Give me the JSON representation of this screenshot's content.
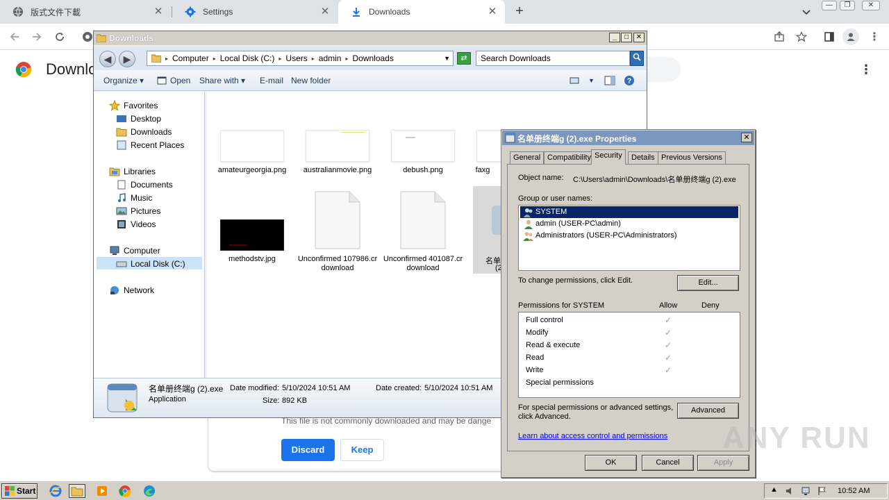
{
  "chrome": {
    "tabs": [
      {
        "label": "版式文件下載",
        "icon": "globe-icon"
      },
      {
        "label": "Settings",
        "icon": "gear-icon"
      },
      {
        "label": "Downloads",
        "icon": "download-icon",
        "active": true
      }
    ],
    "new_tab": "+",
    "page_title": "Downlo",
    "warning_text": "This file is not commonly downloaded and may be dange",
    "discard_label": "Discard",
    "keep_label": "Keep",
    "colors": {
      "tabbar": "#dee1e6",
      "primary": "#1a73e8"
    }
  },
  "explorer": {
    "title": "Downloads",
    "breadcrumb": [
      "Computer",
      "Local Disk (C:)",
      "Users",
      "admin",
      "Downloads"
    ],
    "search_placeholder": "Search Downloads",
    "commands": {
      "organize": "Organize",
      "open": "Open",
      "share": "Share with",
      "email": "E-mail",
      "new_folder": "New folder"
    },
    "nav": {
      "favorites": "Favorites",
      "favorites_items": [
        "Desktop",
        "Downloads",
        "Recent Places"
      ],
      "libraries": "Libraries",
      "libraries_items": [
        "Documents",
        "Music",
        "Pictures",
        "Videos"
      ],
      "computer": "Computer",
      "computer_items": [
        "Local Disk (C:)"
      ],
      "network": "Network"
    },
    "files": [
      {
        "name": "amateurgeorgia.png"
      },
      {
        "name": "australianmovie.png"
      },
      {
        "name": "debush.png"
      },
      {
        "name": "faxg"
      },
      {
        "name": "methodstv.jpg"
      },
      {
        "name": "Unconfirmed 107986.crdownload"
      },
      {
        "name": "Unconfirmed 401087.crdownload"
      },
      {
        "name": "名单"
      },
      {
        "name": "(2"
      }
    ],
    "details": {
      "filename": "名单册终端g (2).exe",
      "type": "Application",
      "date_modified_label": "Date modified:",
      "date_modified": "5/10/2024 10:51 AM",
      "date_created_label": "Date created:",
      "date_created": "5/10/2024 10:51 AM",
      "size_label": "Size:",
      "size": "892 KB"
    }
  },
  "properties": {
    "title": "名单册终端g (2).exe Properties",
    "tabs": [
      "General",
      "Compatibility",
      "Security",
      "Details",
      "Previous Versions"
    ],
    "active_tab": "Security",
    "object_name_label": "Object name:",
    "object_name": "C:\\Users\\admin\\Downloads\\名单册终端g (2).exe",
    "group_label": "Group or user names:",
    "groups": [
      "SYSTEM",
      "admin (USER-PC\\admin)",
      "Administrators (USER-PC\\Administrators)"
    ],
    "change_text": "To change permissions, click Edit.",
    "edit_label": "Edit...",
    "perm_label": "Permissions for SYSTEM",
    "allow_label": "Allow",
    "deny_label": "Deny",
    "permissions": [
      {
        "name": "Full control",
        "allow": true
      },
      {
        "name": "Modify",
        "allow": true
      },
      {
        "name": "Read & execute",
        "allow": true
      },
      {
        "name": "Read",
        "allow": true
      },
      {
        "name": "Write",
        "allow": true
      },
      {
        "name": "Special permissions",
        "allow": false
      }
    ],
    "special_text_1": "For special permissions or advanced settings,",
    "special_text_2": "click Advanced.",
    "advanced_label": "Advanced",
    "learn_link": "Learn about access control and permissions",
    "ok_label": "OK",
    "cancel_label": "Cancel",
    "apply_label": "Apply"
  },
  "taskbar": {
    "start_label": "Start",
    "clock": "10:52 AM"
  },
  "watermark": "ANY RUN"
}
